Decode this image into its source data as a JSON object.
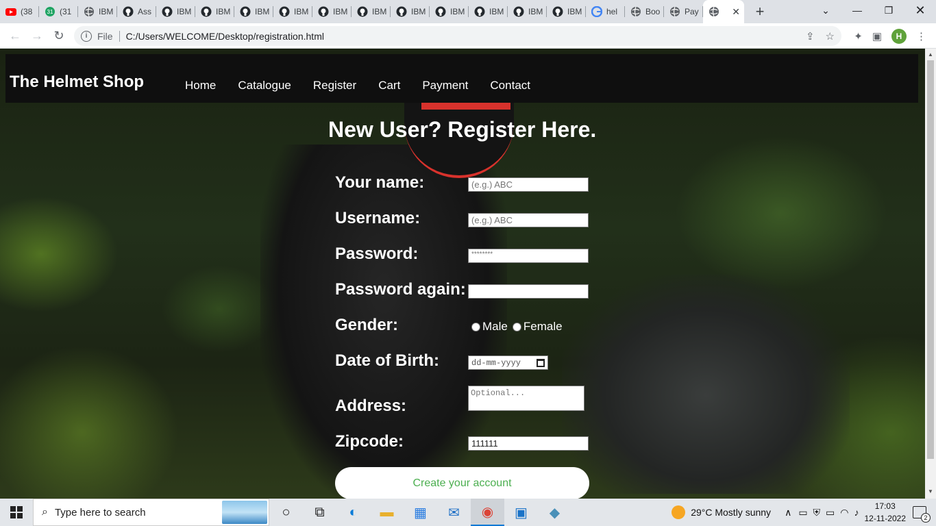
{
  "browser": {
    "tabs": [
      {
        "title": "(38",
        "icon": "youtube-icon"
      },
      {
        "title": "(31",
        "icon": "calendar-icon"
      },
      {
        "title": "IBM",
        "icon": "globe-icon"
      },
      {
        "title": "Ass",
        "icon": "github-icon"
      },
      {
        "title": "IBM",
        "icon": "github-icon"
      },
      {
        "title": "IBM",
        "icon": "github-icon"
      },
      {
        "title": "IBM",
        "icon": "github-icon"
      },
      {
        "title": "IBM",
        "icon": "github-icon"
      },
      {
        "title": "IBM",
        "icon": "github-icon"
      },
      {
        "title": "IBM",
        "icon": "github-icon"
      },
      {
        "title": "IBM",
        "icon": "github-icon"
      },
      {
        "title": "IBM",
        "icon": "github-icon"
      },
      {
        "title": "IBM",
        "icon": "github-icon"
      },
      {
        "title": "IBM",
        "icon": "github-icon"
      },
      {
        "title": "IBM",
        "icon": "github-icon"
      },
      {
        "title": "hel",
        "icon": "google-icon"
      },
      {
        "title": "Boo",
        "icon": "globe-icon"
      },
      {
        "title": "Pay",
        "icon": "globe-icon"
      }
    ],
    "active_tab_icon": "globe-icon",
    "address_scheme": "File",
    "address_url": "C:/Users/WELCOME/Desktop/registration.html",
    "profile_initial": "H"
  },
  "site": {
    "brand": "The Helmet Shop",
    "nav": [
      "Home",
      "Catalogue",
      "Register",
      "Cart",
      "Payment",
      "Contact"
    ]
  },
  "form": {
    "title": "New User? Register Here.",
    "name_label": "Your name:",
    "name_placeholder": "(e.g.) ABC",
    "username_label": "Username:",
    "username_placeholder": "(e.g.) ABC",
    "password_label": "Password:",
    "password_value": "********",
    "password_again_label": "Password again:",
    "gender_label": "Gender:",
    "gender_male": "Male",
    "gender_female": "Female",
    "dob_label": "Date of Birth:",
    "dob_placeholder": "dd-mm-yyyy",
    "address_label": "Address:",
    "address_placeholder": "Optional...",
    "zipcode_label": "Zipcode:",
    "zipcode_value": "111111",
    "submit_label": "Create your account",
    "submit_color": "#4caf50"
  },
  "taskbar": {
    "search_placeholder": "Type here to search",
    "weather": "29°C  Mostly sunny",
    "time": "17:03",
    "date": "12-11-2022",
    "notifications": "2"
  }
}
